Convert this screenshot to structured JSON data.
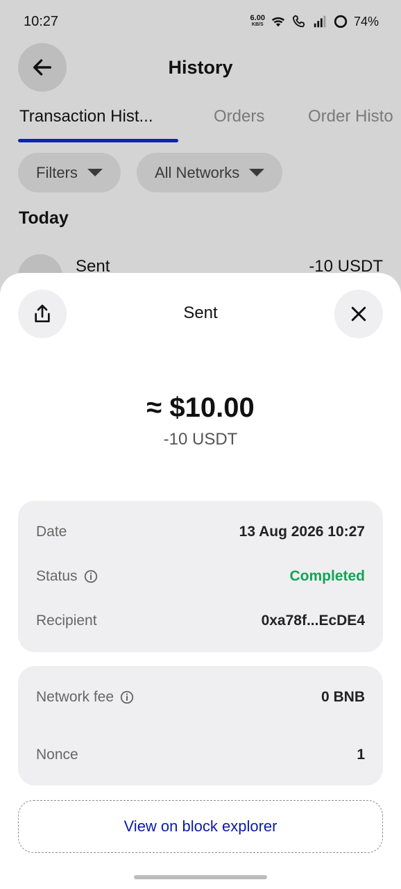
{
  "status_bar": {
    "time": "10:27",
    "net_speed_value": "6.00",
    "net_speed_unit": "KB/S",
    "battery": "74%",
    "icons": [
      "wifi-icon",
      "wifi-call-icon",
      "signal-icon",
      "battery-ring-icon"
    ]
  },
  "header": {
    "title": "History",
    "back_icon": "arrow-left-icon"
  },
  "tabs": [
    {
      "label": "Transaction Hist...",
      "active": true
    },
    {
      "label": "Orders",
      "active": false
    },
    {
      "label": "Order Histo",
      "active": false
    }
  ],
  "filters": {
    "filters_label": "Filters",
    "networks_label": "All Networks"
  },
  "list": {
    "section": "Today",
    "row_label": "Sent",
    "row_amount": "-10 USDT"
  },
  "sheet": {
    "title": "Sent",
    "share_icon": "share-icon",
    "close_icon": "close-icon",
    "amount_fiat": "≈ $10.00",
    "amount_token": "-10 USDT",
    "details": {
      "date_label": "Date",
      "date_value": "13 Aug 2026 10:27",
      "status_label": "Status",
      "status_value": "Completed",
      "recipient_label": "Recipient",
      "recipient_value": "0xa78f...EcDE4"
    },
    "fees": {
      "fee_label": "Network fee",
      "fee_value": "0 BNB",
      "nonce_label": "Nonce",
      "nonce_value": "1"
    },
    "explorer_label": "View on block explorer"
  },
  "colors": {
    "accent_blue": "#0a24b6",
    "status_green": "#12a454",
    "link_blue": "#0a1ba6"
  }
}
